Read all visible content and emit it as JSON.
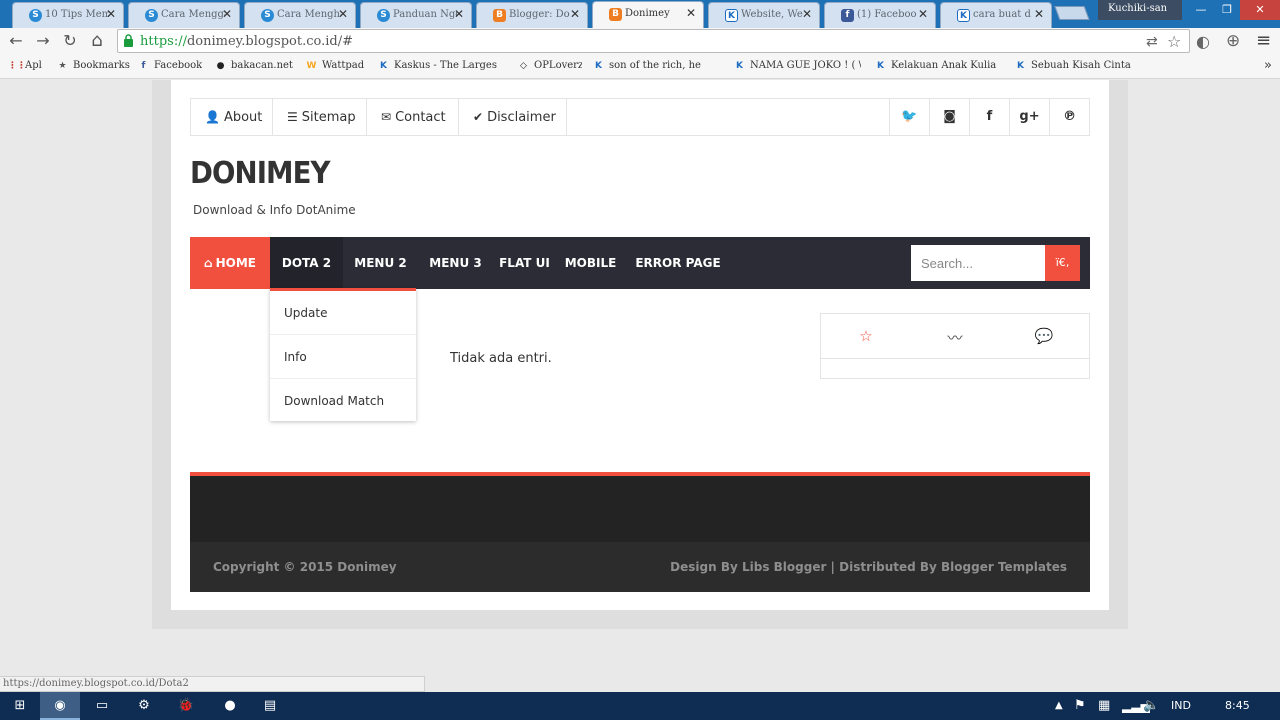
{
  "browser": {
    "tabs": [
      {
        "title": "10 Tips Mem",
        "favicon": "s",
        "favicon_glyph": "S"
      },
      {
        "title": "Cara Mengga",
        "favicon": "s",
        "favicon_glyph": "S"
      },
      {
        "title": "Cara Menghap",
        "favicon": "s",
        "favicon_glyph": "S"
      },
      {
        "title": "Panduan Nge",
        "favicon": "s",
        "favicon_glyph": "S"
      },
      {
        "title": "Blogger: Do",
        "favicon": "b",
        "favicon_glyph": "B"
      },
      {
        "title": "Donimey",
        "favicon": "b",
        "favicon_glyph": "B",
        "active": true
      },
      {
        "title": "Website, We",
        "favicon": "k",
        "favicon_glyph": "K"
      },
      {
        "title": "(1) Faceboo",
        "favicon": "f",
        "favicon_glyph": "f"
      },
      {
        "title": "cara buat d",
        "favicon": "k",
        "favicon_glyph": "K"
      }
    ],
    "tab_close_glyph": "✕",
    "user": "Kuchiki-san",
    "window_buttons": {
      "minimize": "—",
      "maximize": "❐",
      "close": "✕"
    },
    "nav": {
      "back": "←",
      "forward": "→",
      "reload": "↻",
      "home": "⌂"
    },
    "url_scheme": "https://",
    "url_rest": "donimey.blogspot.co.id/#",
    "omnibox_icons": {
      "translate": "⇄",
      "star": "☆",
      "ext": "◐",
      "globe": "⊕",
      "menu": "≡"
    },
    "bookmarks": [
      {
        "label": "Apl",
        "icon": "apps-icon",
        "glyph": "⋮⋮",
        "color": "#c0392b"
      },
      {
        "label": "Bookmarks",
        "icon": "star-icon",
        "glyph": "★",
        "color": "#555555"
      },
      {
        "label": "Facebook",
        "icon": "facebook-icon",
        "glyph": "f",
        "color": "#3b5998"
      },
      {
        "label": "bakacan.net",
        "icon": "bakacan-icon",
        "glyph": "●",
        "color": "#222222"
      },
      {
        "label": "Wattpad",
        "icon": "wattpad-icon",
        "glyph": "W",
        "color": "#f5a623"
      },
      {
        "label": "Kaskus - The Larges",
        "icon": "kaskus-icon",
        "glyph": "K",
        "color": "#1d6cc1"
      },
      {
        "label": "OPLoverz",
        "icon": "oploverz-icon",
        "glyph": "◇",
        "color": "#222222"
      },
      {
        "label": "son of the rich, he",
        "icon": "kaskus-icon",
        "glyph": "K",
        "color": "#1d6cc1"
      },
      {
        "label": "NAMA GUE JOKO ! ( \\",
        "icon": "kaskus-icon",
        "glyph": "K",
        "color": "#1d6cc1"
      },
      {
        "label": "Kelakuan Anak Kulia",
        "icon": "kaskus-icon",
        "glyph": "K",
        "color": "#1d6cc1"
      },
      {
        "label": "Sebuah Kisah Cinta",
        "icon": "kaskus-icon",
        "glyph": "K",
        "color": "#1d6cc1"
      }
    ],
    "bookmarks_more": "»",
    "status_url": "https://donimey.blogspot.co.id/Dota2"
  },
  "site": {
    "top_nav": [
      {
        "label": "About",
        "icon": "user-icon",
        "glyph": "👤"
      },
      {
        "label": "Sitemap",
        "icon": "list-icon",
        "glyph": "☰"
      },
      {
        "label": "Contact",
        "icon": "envelope-icon",
        "glyph": "✉"
      },
      {
        "label": "Disclaimer",
        "icon": "check-circle-icon",
        "glyph": "✔"
      }
    ],
    "social": [
      {
        "name": "twitter-icon",
        "glyph": "🐦"
      },
      {
        "name": "instagram-icon",
        "glyph": "◙"
      },
      {
        "name": "facebook-icon",
        "glyph": "f"
      },
      {
        "name": "google-plus-icon",
        "glyph": "g+"
      },
      {
        "name": "pinterest-icon",
        "glyph": "℗"
      }
    ],
    "brand": "DONIMEY",
    "tagline": "Download & Info DotAnime",
    "main_nav": [
      {
        "label": "HOME",
        "glyph": "⌂"
      },
      {
        "label": "DOTA 2"
      },
      {
        "label": "MENU 2"
      },
      {
        "label": "MENU 3"
      },
      {
        "label": "FLAT UI"
      },
      {
        "label": "MOBILE"
      },
      {
        "label": "ERROR PAGE"
      }
    ],
    "search_placeholder": "Search...",
    "search_button": "ï€‚",
    "dropdown": [
      "Update",
      "Info",
      "Download Match"
    ],
    "no_entries": "Tidak ada entri.",
    "widget_tabs": [
      {
        "name": "star-icon",
        "glyph": "☆"
      },
      {
        "name": "rss-icon",
        "glyph": "〰"
      },
      {
        "name": "comments-icon",
        "glyph": "💬"
      }
    ],
    "footer_left": "Copyright © 2015 Donimey",
    "footer_right": "Design By Libs Blogger | Distributed By Blogger Templates",
    "accent": "#f2503e",
    "nav_bg": "#2b2c35"
  },
  "taskbar": {
    "apps": [
      {
        "name": "windows-start-icon",
        "glyph": "⊞"
      },
      {
        "name": "chrome-icon",
        "glyph": "◉"
      },
      {
        "name": "file-explorer-icon",
        "glyph": "▭"
      },
      {
        "name": "steam-icon",
        "glyph": "⚙"
      },
      {
        "name": "bug-app-icon",
        "glyph": "🐞"
      },
      {
        "name": "line-icon",
        "glyph": "●"
      },
      {
        "name": "notepad-icon",
        "glyph": "▤"
      }
    ],
    "language": "IND",
    "time": "8:45",
    "tray_arrow": "▲"
  }
}
